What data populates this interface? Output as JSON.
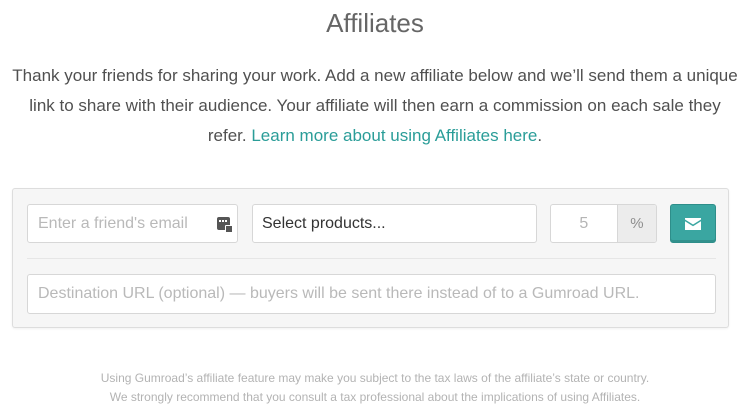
{
  "title": "Affiliates",
  "intro": {
    "text": "Thank your friends for sharing your work. Add a new affiliate below and we’ll send them a unique link to share with their audience. Your affiliate will then earn a commission on each sale they refer. ",
    "link": "Learn more about using Affiliates here",
    "after_link": "."
  },
  "form": {
    "email_placeholder": "Enter a friend's email",
    "products_placeholder": "Select products...",
    "commission_value": "5",
    "commission_unit": "%",
    "destination_placeholder": "Destination URL (optional) — buyers will be sent there instead of to a Gumroad URL."
  },
  "note": {
    "line1": "Using Gumroad’s affiliate feature may make you subject to the tax laws of the affiliate’s state or country.",
    "line2": "We strongly recommend that you consult a tax professional about the implications of using Affiliates."
  },
  "icons": {
    "contact": "contact-card-icon",
    "send": "envelope-icon"
  },
  "colors": {
    "accent": "#3aa6a1",
    "link": "#2a9d98"
  }
}
